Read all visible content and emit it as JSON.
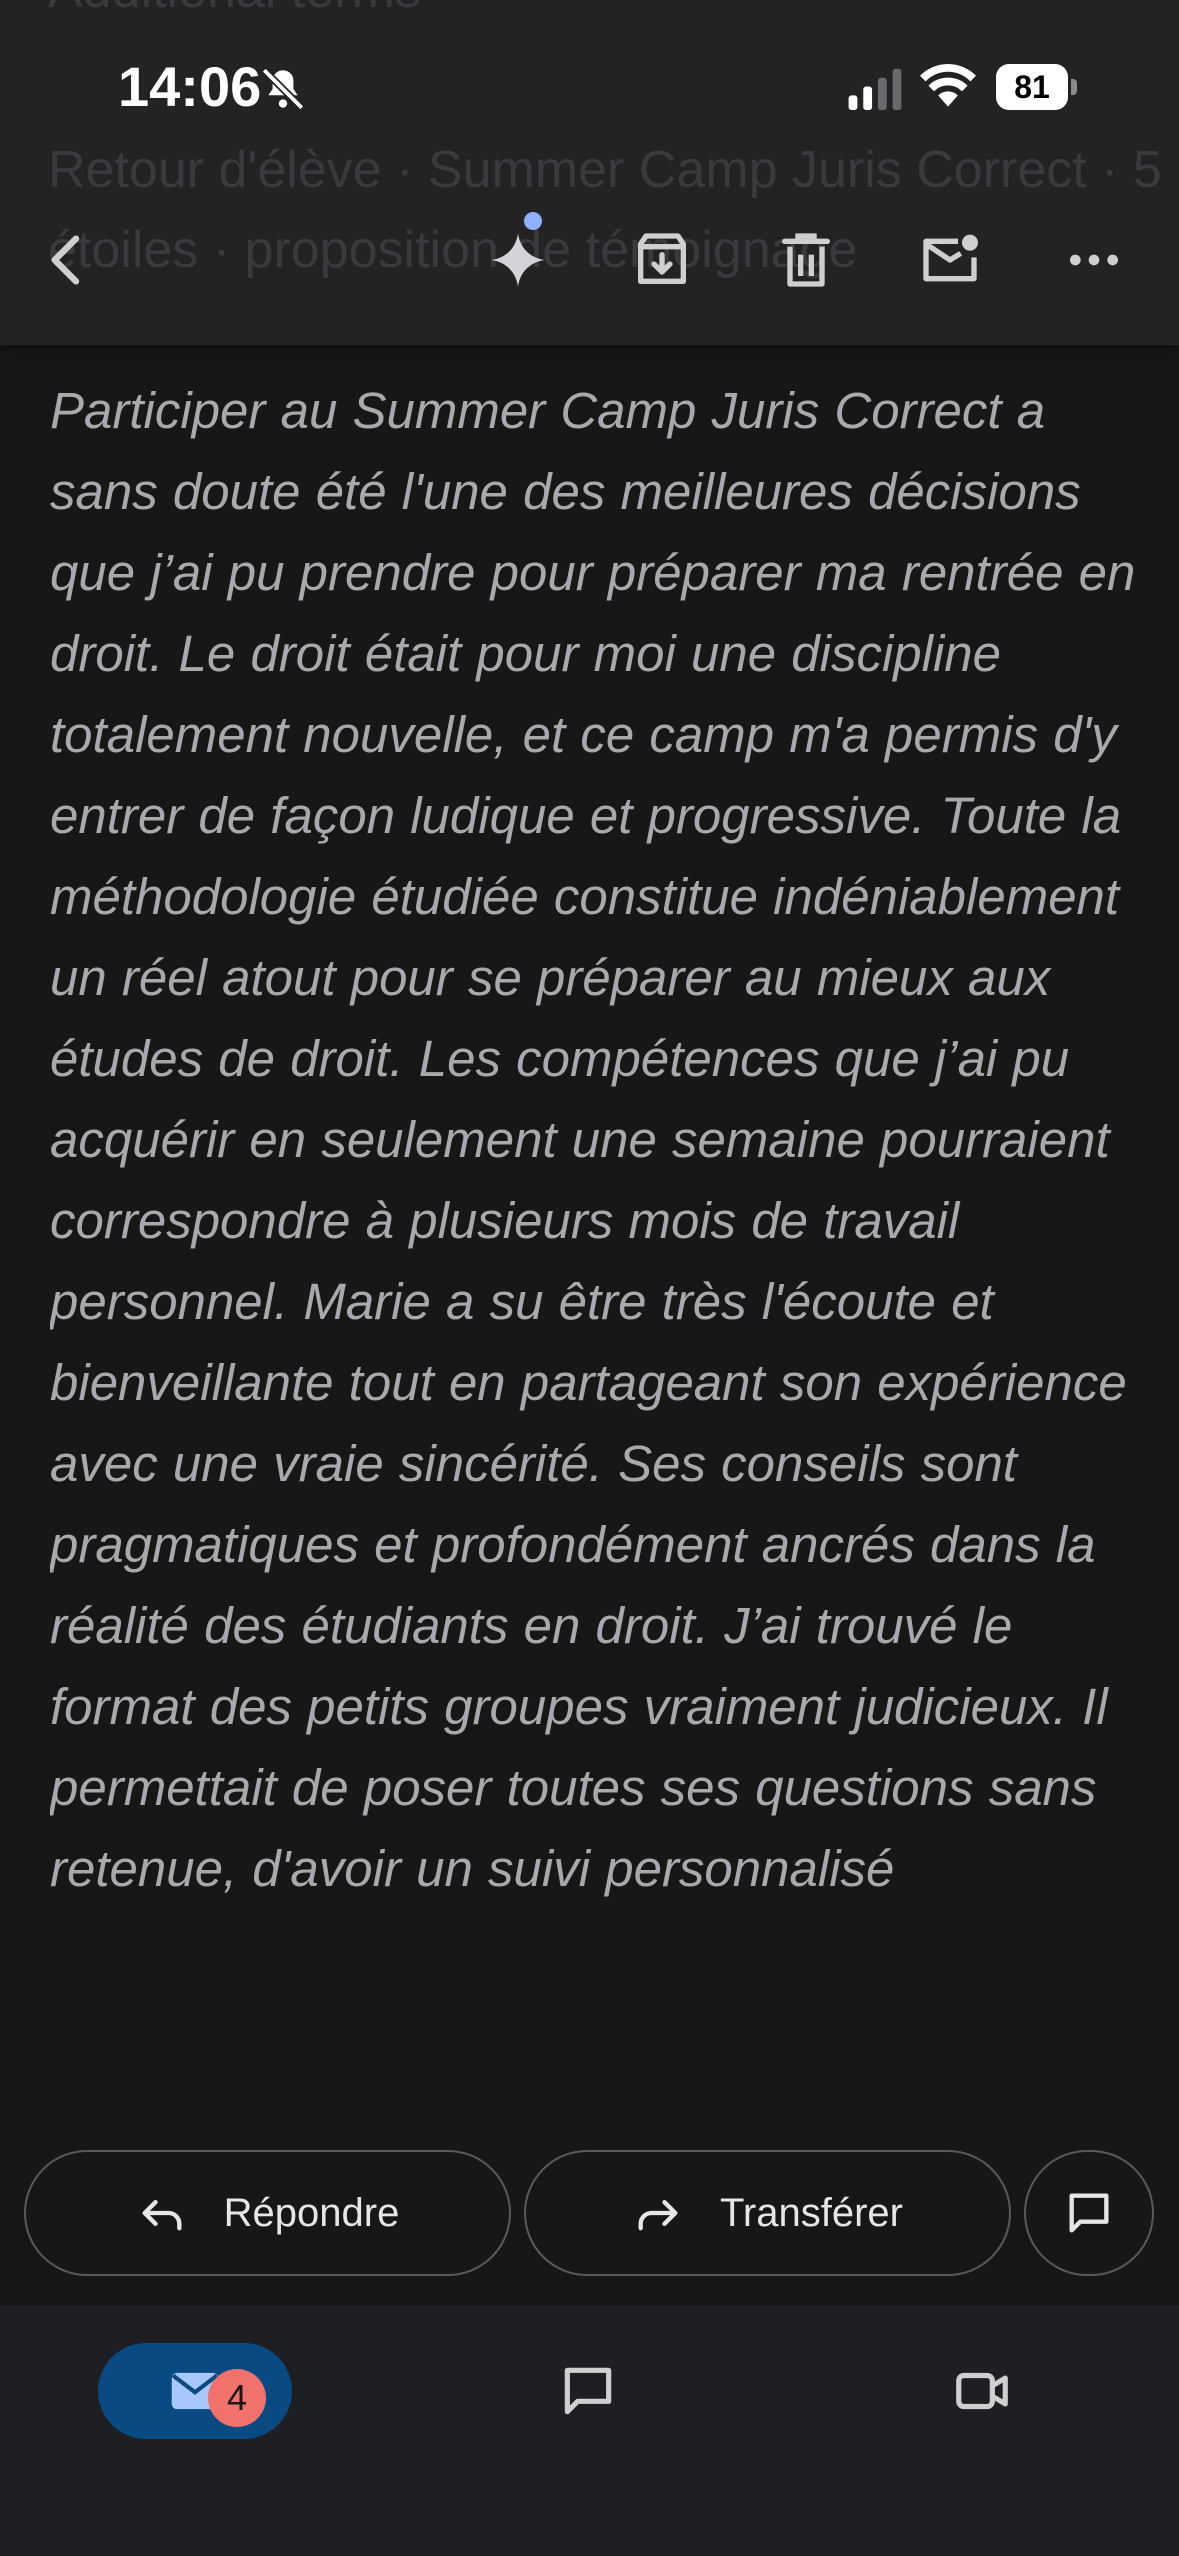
{
  "status_bar": {
    "time": "14:06",
    "battery": "81"
  },
  "header": {
    "ghost_line_1": "Additional terms",
    "ghost_line_2": "Retour d'élève · Summer Camp Juris Correct · 5",
    "ghost_line_3": "étoiles · proposition de témoignage"
  },
  "icons": {
    "back": "back-arrow-icon",
    "gemini": "sparkle-icon",
    "archive": "archive-icon",
    "delete": "trash-icon",
    "unread": "mark-unread-icon",
    "more": "more-icon"
  },
  "body": {
    "text": "Participer au Summer Camp Juris Correct a sans doute été l'une des meilleures décisions que j’ai pu prendre pour préparer ma rentrée en droit. Le droit était pour moi une discipline totalement nouvelle, et ce camp m'a permis d'y entrer de façon ludique et progressive. Toute la méthodologie étudiée constitue indéniablement un réel atout pour se préparer au mieux aux études de droit. Les compétences que j’ai pu acquérir en seulement une semaine pourraient correspondre à plusieurs mois de travail personnel. Marie a su être très l'écoute et bienveillante tout en partageant son expérience avec une vraie sincérité. Ses conseils sont pragmatiques et profondément ancrés dans la réalité des étudiants en droit. J’ai trouvé le format des petits groupes vraiment judicieux. Il permettait de poser toutes ses questions sans retenue, d'avoir un suivi personnalisé"
  },
  "actions": {
    "reply": "Répondre",
    "forward": "Transférer"
  },
  "nav": {
    "mail_badge": "4"
  },
  "colors": {
    "background": "#171718",
    "header": "#232326",
    "accent_tab": "#0a4a82",
    "badge": "#f1726b"
  }
}
